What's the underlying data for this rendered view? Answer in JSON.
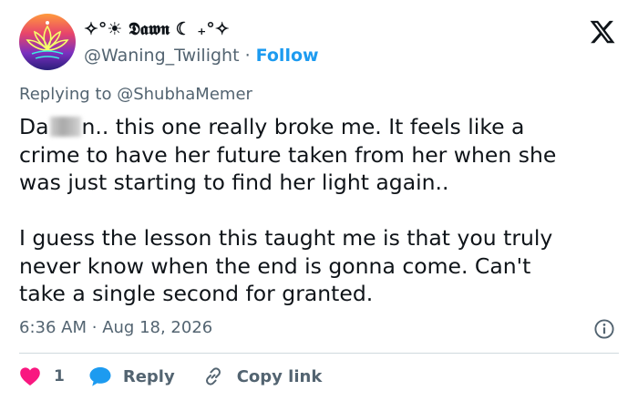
{
  "user": {
    "display_name": "✧°☀ 𝕯𝖆𝖜𝖓 ☾ ₊°✧",
    "handle": "@Waning_Twilight",
    "separator": "·",
    "follow_label": "Follow"
  },
  "reply_context": {
    "prefix": "Replying to ",
    "mention": "@ShubhaMemer"
  },
  "tweet": {
    "line1_start": "Da",
    "line1_end": "n.. this one really broke me. It feels like a",
    "line2": "crime to have her future taken from her when she",
    "line3": "was just starting to find her light again..",
    "line4": "I guess the lesson this taught me is that you truly",
    "line5": "never know when the end is gonna come. Can't",
    "line6": "take a single second for granted."
  },
  "meta": {
    "time": "6:36 AM",
    "separator": "·",
    "date": "Aug 18, 2026"
  },
  "actions": {
    "like_count": "1",
    "reply_label": "Reply",
    "copy_link_label": "Copy link"
  },
  "colors": {
    "accent": "#1d9bf0",
    "like": "#f91880",
    "secondary_text": "#536471",
    "primary_text": "#0f1419",
    "divider": "#cfd9de"
  },
  "icons": {
    "brand": "x-logo-icon",
    "info": "info-icon",
    "like": "heart-icon",
    "reply": "speech-bubble-icon",
    "copy": "link-icon"
  }
}
